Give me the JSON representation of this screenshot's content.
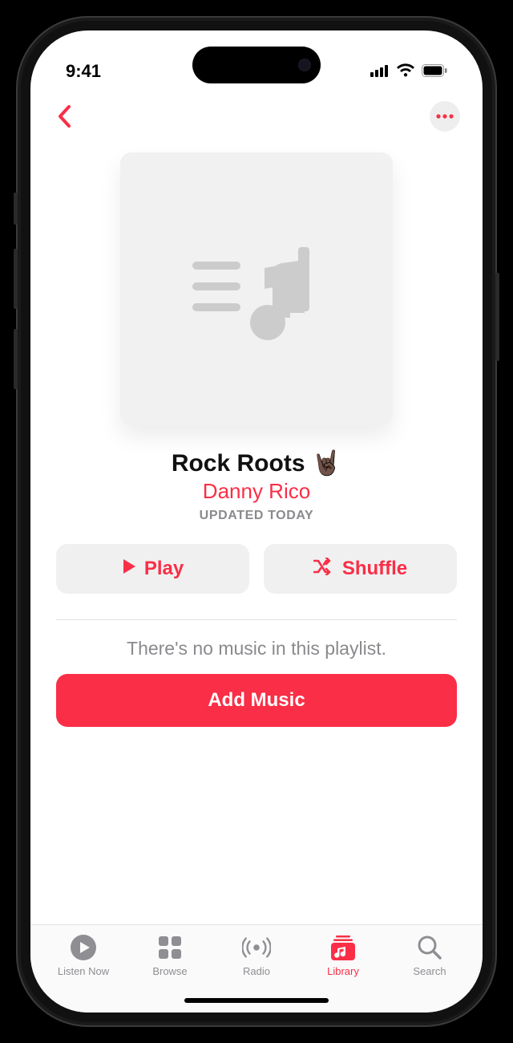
{
  "status": {
    "time": "9:41"
  },
  "playlist": {
    "title": "Rock Roots 🤘🏿",
    "artist": "Danny Rico",
    "updated": "UPDATED TODAY"
  },
  "buttons": {
    "play": "Play",
    "shuffle": "Shuffle",
    "add_music": "Add Music"
  },
  "empty_state": "There's no music in this playlist.",
  "tabs": {
    "listen_now": "Listen Now",
    "browse": "Browse",
    "radio": "Radio",
    "library": "Library",
    "search": "Search"
  },
  "active_tab": "library"
}
